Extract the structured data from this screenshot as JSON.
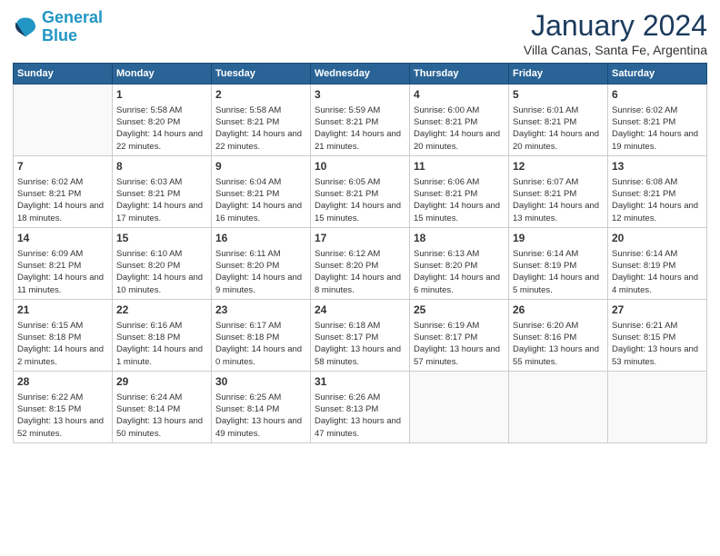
{
  "header": {
    "logo_line1": "General",
    "logo_line2": "Blue",
    "month": "January 2024",
    "location": "Villa Canas, Santa Fe, Argentina"
  },
  "days_of_week": [
    "Sunday",
    "Monday",
    "Tuesday",
    "Wednesday",
    "Thursday",
    "Friday",
    "Saturday"
  ],
  "weeks": [
    [
      {
        "day": "",
        "content": ""
      },
      {
        "day": "1",
        "sunrise": "5:58 AM",
        "sunset": "8:20 PM",
        "daylight": "14 hours and 22 minutes."
      },
      {
        "day": "2",
        "sunrise": "5:58 AM",
        "sunset": "8:21 PM",
        "daylight": "14 hours and 22 minutes."
      },
      {
        "day": "3",
        "sunrise": "5:59 AM",
        "sunset": "8:21 PM",
        "daylight": "14 hours and 21 minutes."
      },
      {
        "day": "4",
        "sunrise": "6:00 AM",
        "sunset": "8:21 PM",
        "daylight": "14 hours and 20 minutes."
      },
      {
        "day": "5",
        "sunrise": "6:01 AM",
        "sunset": "8:21 PM",
        "daylight": "14 hours and 20 minutes."
      },
      {
        "day": "6",
        "sunrise": "6:02 AM",
        "sunset": "8:21 PM",
        "daylight": "14 hours and 19 minutes."
      }
    ],
    [
      {
        "day": "7",
        "sunrise": "6:02 AM",
        "sunset": "8:21 PM",
        "daylight": "14 hours and 18 minutes."
      },
      {
        "day": "8",
        "sunrise": "6:03 AM",
        "sunset": "8:21 PM",
        "daylight": "14 hours and 17 minutes."
      },
      {
        "day": "9",
        "sunrise": "6:04 AM",
        "sunset": "8:21 PM",
        "daylight": "14 hours and 16 minutes."
      },
      {
        "day": "10",
        "sunrise": "6:05 AM",
        "sunset": "8:21 PM",
        "daylight": "14 hours and 15 minutes."
      },
      {
        "day": "11",
        "sunrise": "6:06 AM",
        "sunset": "8:21 PM",
        "daylight": "14 hours and 15 minutes."
      },
      {
        "day": "12",
        "sunrise": "6:07 AM",
        "sunset": "8:21 PM",
        "daylight": "14 hours and 13 minutes."
      },
      {
        "day": "13",
        "sunrise": "6:08 AM",
        "sunset": "8:21 PM",
        "daylight": "14 hours and 12 minutes."
      }
    ],
    [
      {
        "day": "14",
        "sunrise": "6:09 AM",
        "sunset": "8:21 PM",
        "daylight": "14 hours and 11 minutes."
      },
      {
        "day": "15",
        "sunrise": "6:10 AM",
        "sunset": "8:20 PM",
        "daylight": "14 hours and 10 minutes."
      },
      {
        "day": "16",
        "sunrise": "6:11 AM",
        "sunset": "8:20 PM",
        "daylight": "14 hours and 9 minutes."
      },
      {
        "day": "17",
        "sunrise": "6:12 AM",
        "sunset": "8:20 PM",
        "daylight": "14 hours and 8 minutes."
      },
      {
        "day": "18",
        "sunrise": "6:13 AM",
        "sunset": "8:20 PM",
        "daylight": "14 hours and 6 minutes."
      },
      {
        "day": "19",
        "sunrise": "6:14 AM",
        "sunset": "8:19 PM",
        "daylight": "14 hours and 5 minutes."
      },
      {
        "day": "20",
        "sunrise": "6:14 AM",
        "sunset": "8:19 PM",
        "daylight": "14 hours and 4 minutes."
      }
    ],
    [
      {
        "day": "21",
        "sunrise": "6:15 AM",
        "sunset": "8:18 PM",
        "daylight": "14 hours and 2 minutes."
      },
      {
        "day": "22",
        "sunrise": "6:16 AM",
        "sunset": "8:18 PM",
        "daylight": "14 hours and 1 minute."
      },
      {
        "day": "23",
        "sunrise": "6:17 AM",
        "sunset": "8:18 PM",
        "daylight": "14 hours and 0 minutes."
      },
      {
        "day": "24",
        "sunrise": "6:18 AM",
        "sunset": "8:17 PM",
        "daylight": "13 hours and 58 minutes."
      },
      {
        "day": "25",
        "sunrise": "6:19 AM",
        "sunset": "8:17 PM",
        "daylight": "13 hours and 57 minutes."
      },
      {
        "day": "26",
        "sunrise": "6:20 AM",
        "sunset": "8:16 PM",
        "daylight": "13 hours and 55 minutes."
      },
      {
        "day": "27",
        "sunrise": "6:21 AM",
        "sunset": "8:15 PM",
        "daylight": "13 hours and 53 minutes."
      }
    ],
    [
      {
        "day": "28",
        "sunrise": "6:22 AM",
        "sunset": "8:15 PM",
        "daylight": "13 hours and 52 minutes."
      },
      {
        "day": "29",
        "sunrise": "6:24 AM",
        "sunset": "8:14 PM",
        "daylight": "13 hours and 50 minutes."
      },
      {
        "day": "30",
        "sunrise": "6:25 AM",
        "sunset": "8:14 PM",
        "daylight": "13 hours and 49 minutes."
      },
      {
        "day": "31",
        "sunrise": "6:26 AM",
        "sunset": "8:13 PM",
        "daylight": "13 hours and 47 minutes."
      },
      {
        "day": "",
        "content": ""
      },
      {
        "day": "",
        "content": ""
      },
      {
        "day": "",
        "content": ""
      }
    ]
  ]
}
